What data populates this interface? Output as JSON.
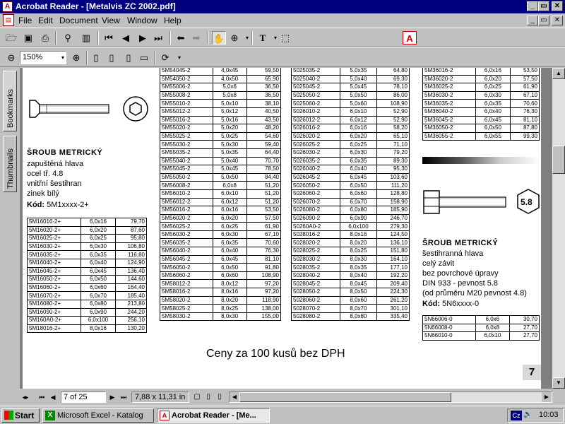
{
  "window": {
    "title": "Acrobat Reader - [Metalvis ZC 2002.pdf]",
    "app_icon": "acrobat-icon",
    "min_glyph": "_",
    "max_glyph": "▭",
    "close_glyph": "✕"
  },
  "menu": {
    "items": [
      "File",
      "Edit",
      "Document",
      "View",
      "Window",
      "Help"
    ]
  },
  "toolbar": {
    "zoom_value": "150%",
    "text_tool": "T"
  },
  "side_tabs": [
    "Bookmarks",
    "Thumbnails"
  ],
  "page": {
    "left_title": "ŠROUB METRICKÝ",
    "left_lines": [
      "zapuštěná hlava",
      "ocel tř. 4.8",
      "vnitřní šestihran",
      "zinek bílý"
    ],
    "left_code_label": "Kód:",
    "left_code_value": "5M1xxxx-2+",
    "right_title": "ŠROUB METRICKÝ",
    "right_lines": [
      "šestihranná hlava",
      "celý závit",
      "bez povrchové úpravy",
      "DIN 933 - pevnost 5.8",
      "(od průměru M20 pevnost 4.8)"
    ],
    "right_code_label": "Kód:",
    "right_code_value": "5N6xxxx-0",
    "nut_label": "5.8",
    "footer": "Ceny  za 100 kusů bez DPH",
    "page_number": "7",
    "table_left": [
      [
        "5M16016-2+",
        "6,0x16",
        "79,70"
      ],
      [
        "5M16020-2+",
        "6,0x20",
        "87,60"
      ],
      [
        "5M16025-2+",
        "6,0x25",
        "95,80"
      ],
      [
        "5M16030-2+",
        "6,0x30",
        "106,80"
      ],
      [
        "5M16035-2+",
        "6,0x35",
        "116,80"
      ],
      [
        "5M16040-2+",
        "6,0x40",
        "124,90"
      ],
      [
        "5M16045-2+",
        "6,0x45",
        "136,40"
      ],
      [
        "5M16050-2+",
        "6,0x50",
        "144,60"
      ],
      [
        "5M16060-2+",
        "6,0x60",
        "164,40"
      ],
      [
        "5M16070-2+",
        "6,0x70",
        "185,40"
      ],
      [
        "5M16080-2+",
        "6,0x80",
        "213,80"
      ],
      [
        "5M16090-2+",
        "6,0x90",
        "244,20"
      ],
      [
        "5M160A0-2+",
        "6,0x100",
        "256,10"
      ],
      [
        "5M18016-2+",
        "8,0x16",
        "130,20"
      ]
    ],
    "table_mid1": [
      [
        "5M54045-2",
        "4,0x45",
        "59,50"
      ],
      [
        "5M54050-2",
        "4,0x50",
        "65,90"
      ],
      [
        "5M55006-2",
        "5,0x6",
        "36,50"
      ],
      [
        "5M55008-2",
        "5,0x8",
        "36,50"
      ],
      [
        "5M55010-2",
        "5,0x10",
        "38,10"
      ],
      [
        "5M55012-2",
        "5,0x12",
        "40,50"
      ],
      [
        "5M55016-2",
        "5,0x16",
        "43,50"
      ],
      [
        "5M55020-2",
        "5,0x20",
        "48,20"
      ],
      [
        "5M55025-2",
        "5,0x25",
        "54,60"
      ],
      [
        "5M55030-2",
        "5,0x30",
        "59,40"
      ],
      [
        "5M55035-2",
        "5,0x35",
        "64,40"
      ],
      [
        "5M55040-2",
        "5,0x40",
        "70,70"
      ],
      [
        "5M55045-2",
        "5,0x45",
        "78,50"
      ],
      [
        "5M55050-2",
        "5,0x50",
        "84,40"
      ],
      [
        "5M56008-2",
        "6,0x8",
        "51,20"
      ],
      [
        "5M56010-2",
        "6,0x10",
        "51,20"
      ],
      [
        "5M56012-2",
        "6,0x12",
        "51,20"
      ],
      [
        "5M56016-2",
        "6,0x16",
        "53,50"
      ],
      [
        "5M56020-2",
        "6,0x20",
        "57,50"
      ],
      [
        "5M56025-2",
        "6,0x25",
        "61,90"
      ],
      [
        "5M56030-2",
        "6,0x30",
        "67,10"
      ],
      [
        "5M56035-2",
        "6,0x35",
        "70,60"
      ],
      [
        "5M56040-2",
        "6,0x40",
        "76,30"
      ],
      [
        "5M56045-2",
        "6,0x45",
        "81,10"
      ],
      [
        "5M56050-2",
        "6,0x50",
        "91,80"
      ],
      [
        "5M56060-2",
        "6,0x60",
        "108,90"
      ],
      [
        "5M58012-2",
        "8,0x12",
        "97,20"
      ],
      [
        "5M58016-2",
        "8,0x16",
        "97,20"
      ],
      [
        "5M58020-2",
        "8,0x20",
        "118,90"
      ],
      [
        "5M58025-2",
        "8,0x25",
        "138,00"
      ],
      [
        "5M58030-2",
        "8,0x30",
        "155,00"
      ]
    ],
    "table_mid2": [
      [
        "5025035-2",
        "5,0x35",
        "64,80"
      ],
      [
        "5025040-2",
        "5,0x40",
        "69,30"
      ],
      [
        "5025045-2",
        "5,0x45",
        "78,10"
      ],
      [
        "5025050-2",
        "5,0x50",
        "86,00"
      ],
      [
        "5025060-2",
        "5,0x60",
        "108,90"
      ],
      [
        "5026010-2",
        "6,0x10",
        "52,90"
      ],
      [
        "5026012-2",
        "6,0x12",
        "52,90"
      ],
      [
        "5026016-2",
        "6,0x16",
        "58,20"
      ],
      [
        "5026020-2",
        "6,0x20",
        "65,10"
      ],
      [
        "5026025-2",
        "6,0x25",
        "71,10"
      ],
      [
        "5026030-2",
        "6,0x30",
        "79,20"
      ],
      [
        "5026035-2",
        "6,0x35",
        "89,30"
      ],
      [
        "5026040-2",
        "6,0x40",
        "95,30"
      ],
      [
        "5026045-2",
        "6,0x45",
        "103,60"
      ],
      [
        "5026050-2",
        "6,0x50",
        "111,20"
      ],
      [
        "5026060-2",
        "6,0x60",
        "128,80"
      ],
      [
        "5026070-2",
        "6,0x70",
        "158,90"
      ],
      [
        "5026080-2",
        "6,0x80",
        "185,90"
      ],
      [
        "5026090-2",
        "6,0x90",
        "246,70"
      ],
      [
        "50260A0-2",
        "6,0x100",
        "279,30"
      ],
      [
        "5028016-2",
        "8,0x16",
        "124,50"
      ],
      [
        "5028020-2",
        "8,0x20",
        "136,10"
      ],
      [
        "5028025-2",
        "8,0x25",
        "151,80"
      ],
      [
        "5028030-2",
        "8,0x30",
        "164,10"
      ],
      [
        "5028035-2",
        "8,0x35",
        "177,10"
      ],
      [
        "5028040-2",
        "8,0x40",
        "192,20"
      ],
      [
        "5028045-2",
        "8,0x45",
        "209,40"
      ],
      [
        "5028050-2",
        "8,0x50",
        "224,30"
      ],
      [
        "5028060-2",
        "8,0x60",
        "261,20"
      ],
      [
        "5028070-2",
        "8,0x70",
        "301,10"
      ],
      [
        "5028080-2",
        "8,0x80",
        "335,40"
      ]
    ],
    "table_right": [
      [
        "5M36016-2",
        "6,0x16",
        "53,50"
      ],
      [
        "5M36020-2",
        "6,0x20",
        "57,50"
      ],
      [
        "5M36025-2",
        "6,0x25",
        "61,90"
      ],
      [
        "5M36030-2",
        "6,0x30",
        "67,10"
      ],
      [
        "5M36035-2",
        "6,0x35",
        "70,60"
      ],
      [
        "5M36040-2",
        "6,0x40",
        "76,30"
      ],
      [
        "5M36045-2",
        "6,0x45",
        "81,10"
      ],
      [
        "5M36050-2",
        "6,0x50",
        "87,80"
      ],
      [
        "5M36055-2",
        "6,0x55",
        "99,30"
      ]
    ],
    "table_right2": [
      [
        "5N66006-0",
        "6,0x6",
        "30,70"
      ],
      [
        "5N66008-0",
        "6,0x8",
        "27,70"
      ],
      [
        "5N66010-0",
        "6,0x10",
        "27,70"
      ]
    ]
  },
  "status": {
    "page_field": "7 of 25",
    "page_size": "7,88 x 11,31 in"
  },
  "taskbar": {
    "start": "Start",
    "tasks": [
      "Microsoft Excel - Katalog",
      "Acrobat Reader - [Me..."
    ],
    "lang": "Cz",
    "clock": "10:03"
  }
}
